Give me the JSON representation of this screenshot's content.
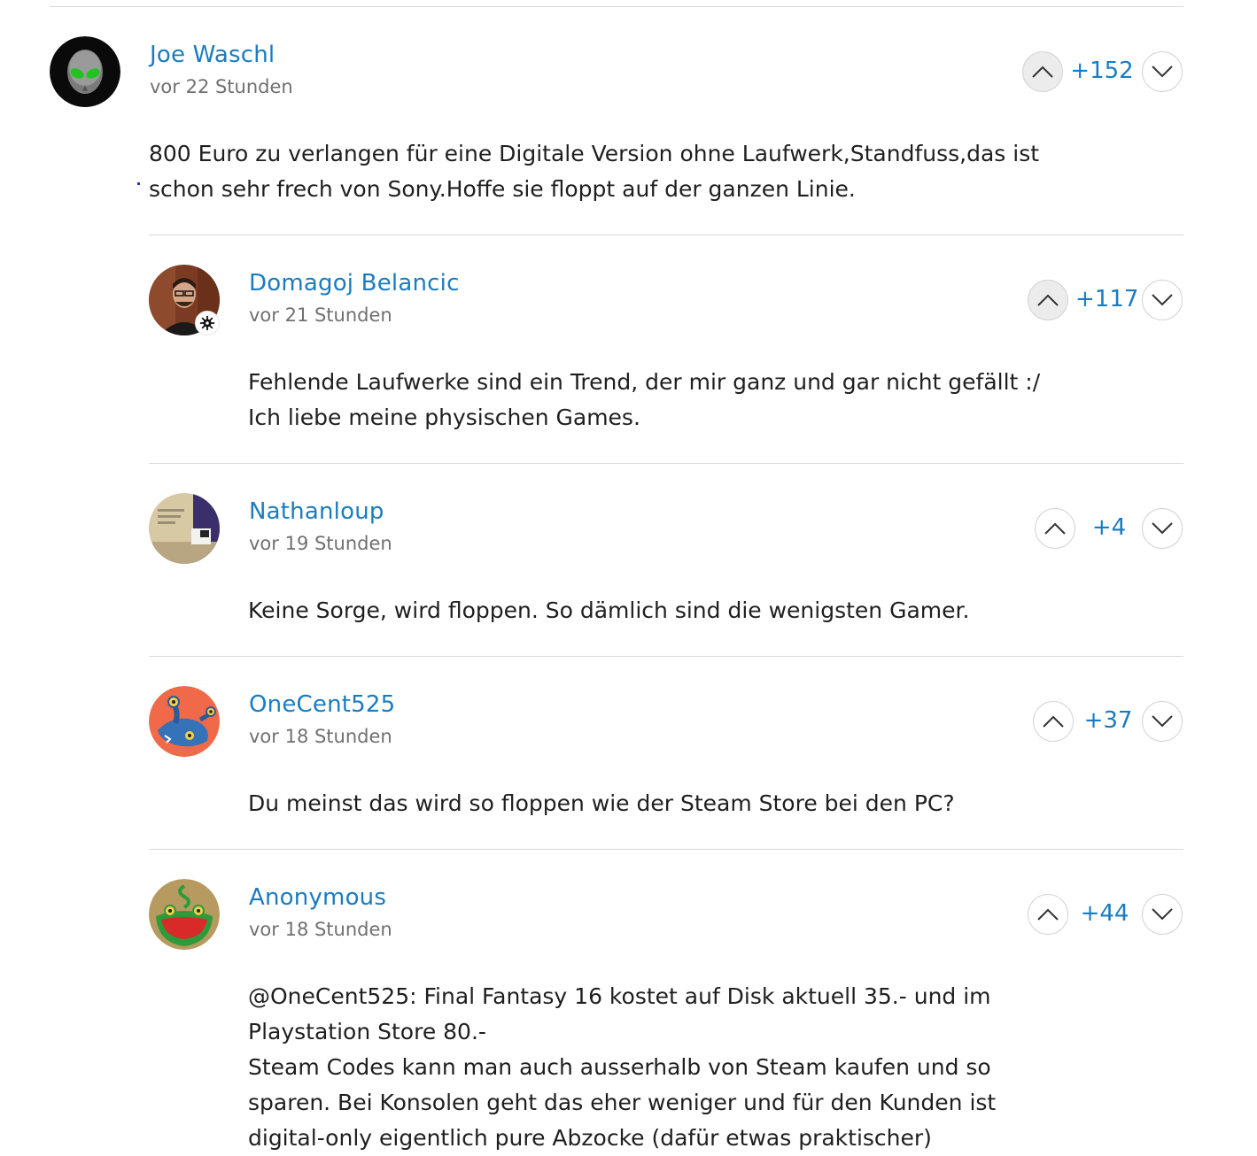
{
  "comments": [
    {
      "author": "Joe Waschl",
      "time": "vor 22 Stunden",
      "score": "+152",
      "upvoted": true,
      "avatar_icon": "alien-avatar",
      "text": [
        "800 Euro zu verlangen für eine Digitale Version ohne Laufwerk,Standfuss,das ist",
        "schon sehr frech von Sony.Hoffe sie floppt auf der ganzen Linie."
      ]
    },
    {
      "author": "Domagoj Belancic",
      "time": "vor 21 Stunden",
      "score": "+117",
      "upvoted": true,
      "avatar_icon": "person-photo-avatar",
      "badge_icon": "gear-badge-icon",
      "text": [
        "Fehlende Laufwerke sind ein Trend, der mir ganz und gar nicht gefällt :/",
        "Ich liebe meine physischen Games."
      ]
    },
    {
      "author": "Nathanloup",
      "time": "vor 19 Stunden",
      "score": "+4",
      "upvoted": false,
      "avatar_icon": "photo-avatar",
      "text": [
        "Keine Sorge, wird floppen. So dämlich sind die wenigsten Gamer."
      ]
    },
    {
      "author": "OneCent525",
      "time": "vor 18 Stunden",
      "score": "+37",
      "upvoted": false,
      "avatar_icon": "monster-avatar",
      "text": [
        "Du meinst das wird so floppen wie der Steam Store bei den PC?"
      ]
    },
    {
      "author": "Anonymous",
      "time": "vor 18 Stunden",
      "score": "+44",
      "upvoted": false,
      "avatar_icon": "frog-monster-avatar",
      "text": [
        "@OneCent525: Final Fantasy 16 kostet auf Disk aktuell 35.- und im",
        "Playstation Store 80.-",
        "Steam Codes kann man auch ausserhalb von Steam kaufen und so",
        "sparen. Bei Konsolen geht das eher weniger und für den Kunden ist",
        "digital-only eigentlich pure Abzocke (dafür etwas praktischer)"
      ]
    }
  ],
  "icons": {
    "vote_up": "chevron-up-icon",
    "vote_down": "chevron-down-icon"
  },
  "colors": {
    "accent": "#1a7cc0",
    "muted_text": "#707070",
    "divider": "#d9d9d9"
  }
}
